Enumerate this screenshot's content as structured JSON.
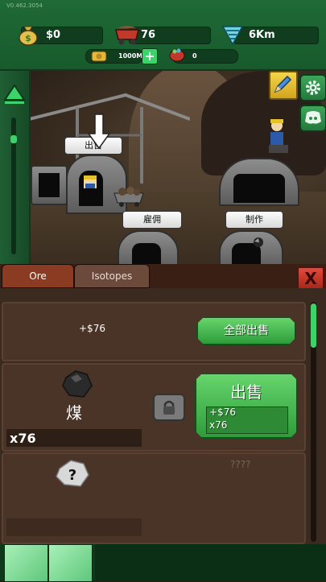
{
  "version": "V0.462.3054",
  "hud": {
    "money": "$0",
    "minecarts": "76",
    "depth": "6Km",
    "mine_size": "1000M",
    "gems": "0"
  },
  "scene": {
    "signs": {
      "sell": "出售",
      "hire": "雇佣",
      "craft": "制作"
    }
  },
  "tabs": {
    "ore": "Ore",
    "isotopes": "Isotopes",
    "close": "X"
  },
  "ore_panel": {
    "total_value": "+$76",
    "sell_all_label": "全部出售",
    "items": [
      {
        "name": "煤",
        "count": "x76",
        "sell_label": "出售",
        "sell_value": "+$76",
        "sell_count": "x76"
      },
      {
        "name": "????",
        "count": ""
      }
    ]
  },
  "colors": {
    "accent_green": "#3bd36a",
    "panel_brown": "#4a3427",
    "hud_green": "#1f6a36"
  }
}
